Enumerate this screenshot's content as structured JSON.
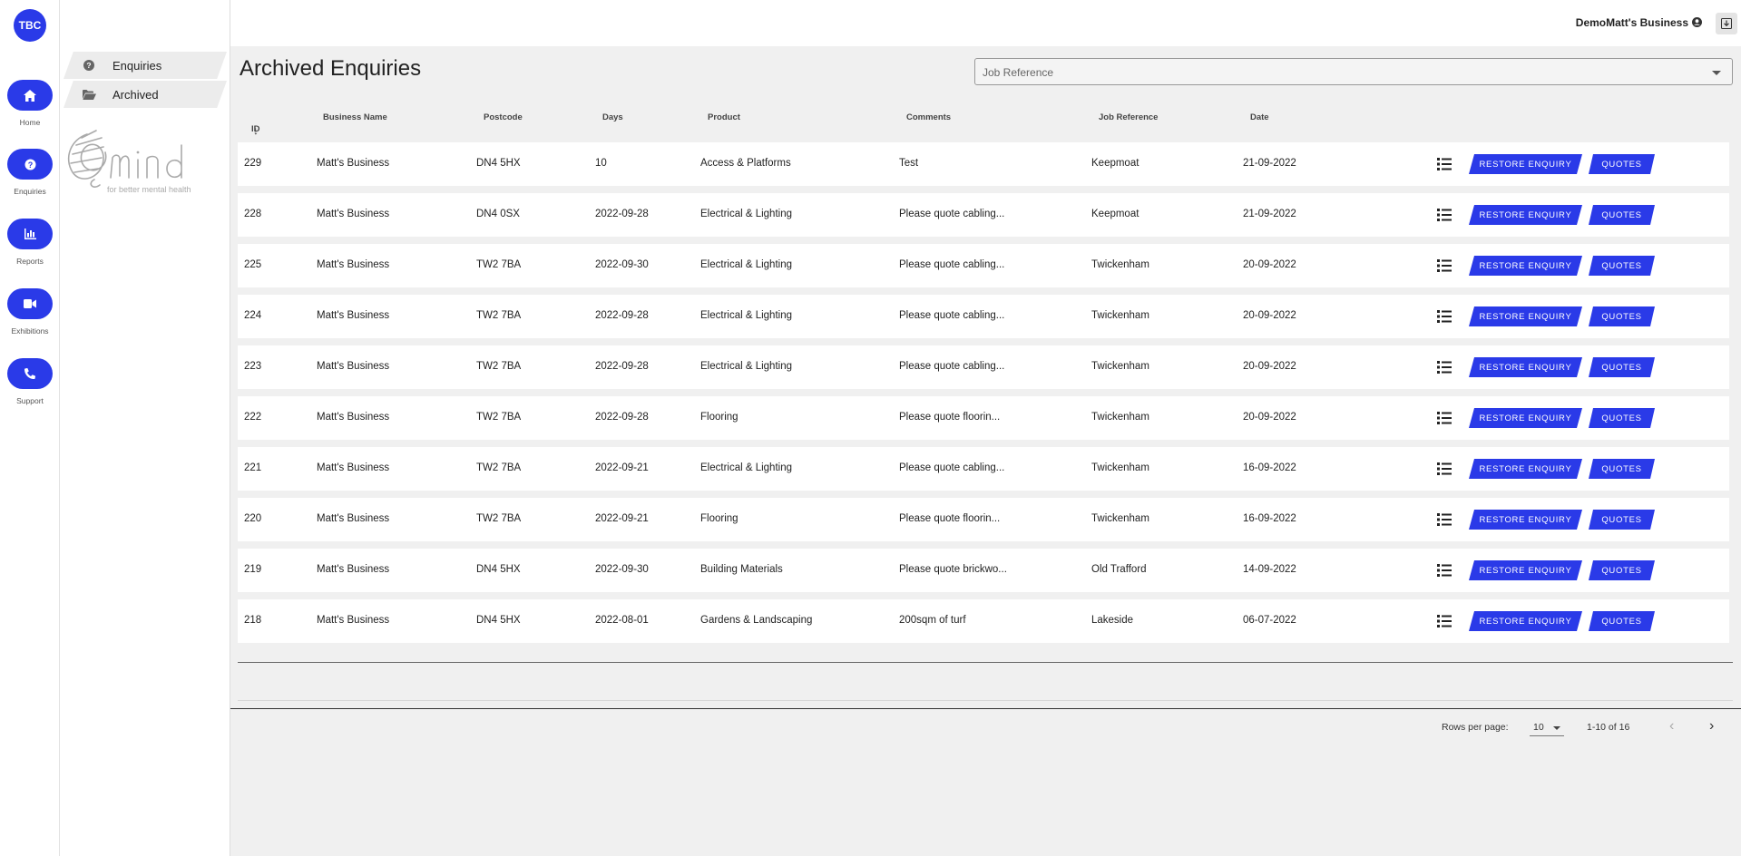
{
  "rail": {
    "logo": "TBC",
    "items": [
      {
        "label": "Home",
        "icon": "home-icon"
      },
      {
        "label": "Enquiries",
        "icon": "help-icon"
      },
      {
        "label": "Reports",
        "icon": "chart-icon"
      },
      {
        "label": "Exhibitions",
        "icon": "video-icon"
      },
      {
        "label": "Support",
        "icon": "phone-icon"
      }
    ]
  },
  "subnav": {
    "items": [
      {
        "label": "Enquiries",
        "icon": "help-circle-icon"
      },
      {
        "label": "Archived",
        "icon": "folder-open-icon"
      }
    ],
    "brand": {
      "name": "mind",
      "tagline": "for better mental health"
    }
  },
  "header": {
    "business": "DemoMatt's Business"
  },
  "main": {
    "title": "Archived Enquiries",
    "filter": {
      "placeholder": "Job Reference"
    },
    "columns": [
      "ID",
      "Business Name",
      "Postcode",
      "Days",
      "Product",
      "Comments",
      "Job Reference",
      "Date"
    ],
    "actions": {
      "restore": "RESTORE ENQUIRY",
      "quotes": "QUOTES"
    },
    "rows": [
      {
        "id": "229",
        "business": "Matt's Business",
        "postcode": "DN4 5HX",
        "days": "10",
        "product": "Access & Platforms",
        "comments": "Test",
        "job_ref": "Keepmoat",
        "date": "21-09-2022"
      },
      {
        "id": "228",
        "business": "Matt's Business",
        "postcode": "DN4 0SX",
        "days": "2022-09-28",
        "product": "Electrical & Lighting",
        "comments": "Please quote cabling...",
        "job_ref": "Keepmoat",
        "date": "21-09-2022"
      },
      {
        "id": "225",
        "business": "Matt's Business",
        "postcode": "TW2 7BA",
        "days": "2022-09-30",
        "product": "Electrical & Lighting",
        "comments": "Please quote cabling...",
        "job_ref": "Twickenham",
        "date": "20-09-2022"
      },
      {
        "id": "224",
        "business": "Matt's Business",
        "postcode": "TW2 7BA",
        "days": "2022-09-28",
        "product": "Electrical & Lighting",
        "comments": "Please quote cabling...",
        "job_ref": "Twickenham",
        "date": "20-09-2022"
      },
      {
        "id": "223",
        "business": "Matt's Business",
        "postcode": "TW2 7BA",
        "days": "2022-09-28",
        "product": "Electrical & Lighting",
        "comments": "Please quote cabling...",
        "job_ref": "Twickenham",
        "date": "20-09-2022"
      },
      {
        "id": "222",
        "business": "Matt's Business",
        "postcode": "TW2 7BA",
        "days": "2022-09-28",
        "product": "Flooring",
        "comments": "Please quote floorin...",
        "job_ref": "Twickenham",
        "date": "20-09-2022"
      },
      {
        "id": "221",
        "business": "Matt's Business",
        "postcode": "TW2 7BA",
        "days": "2022-09-21",
        "product": "Electrical & Lighting",
        "comments": "Please quote cabling...",
        "job_ref": "Twickenham",
        "date": "16-09-2022"
      },
      {
        "id": "220",
        "business": "Matt's Business",
        "postcode": "TW2 7BA",
        "days": "2022-09-21",
        "product": "Flooring",
        "comments": "Please quote floorin...",
        "job_ref": "Twickenham",
        "date": "16-09-2022"
      },
      {
        "id": "219",
        "business": "Matt's Business",
        "postcode": "DN4 5HX",
        "days": "2022-09-30",
        "product": "Building Materials",
        "comments": "Please quote brickwo...",
        "job_ref": "Old Trafford",
        "date": "14-09-2022"
      },
      {
        "id": "218",
        "business": "Matt's Business",
        "postcode": "DN4 5HX",
        "days": "2022-08-01",
        "product": "Gardens & Landscaping",
        "comments": "200sqm of turf",
        "job_ref": "Lakeside",
        "date": "06-07-2022"
      }
    ]
  },
  "pagination": {
    "rows_per_page_label": "Rows per page:",
    "rows_per_page": "10",
    "range": "1-10 of 16",
    "prev": "‹",
    "next": "›"
  },
  "colors": {
    "accent": "#2a3ae8",
    "background": "#f0f0f0"
  }
}
